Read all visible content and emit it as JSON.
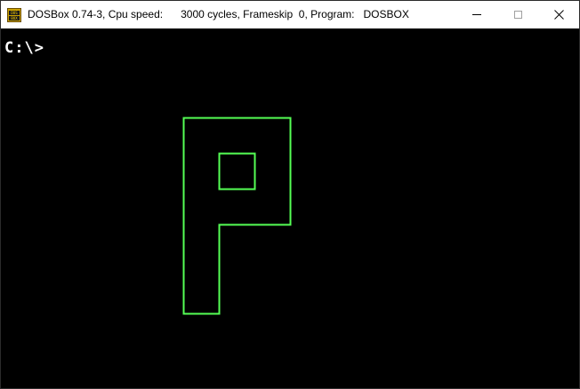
{
  "window": {
    "title": "DOSBox 0.74-3, Cpu speed:      3000 cycles, Frameskip  0, Program:   DOSBOX",
    "icon_label_top": "DOS",
    "icon_label_bottom": "BOX",
    "controls": {
      "minimize": "minimize-icon",
      "maximize": "maximize-icon",
      "close": "close-icon"
    }
  },
  "screen": {
    "background": "#000000",
    "prompt": "C:\\>",
    "prompt_color": "#ffffff",
    "drawing": {
      "shape": "letter-P-outline",
      "stroke_color": "#55ff55"
    }
  }
}
